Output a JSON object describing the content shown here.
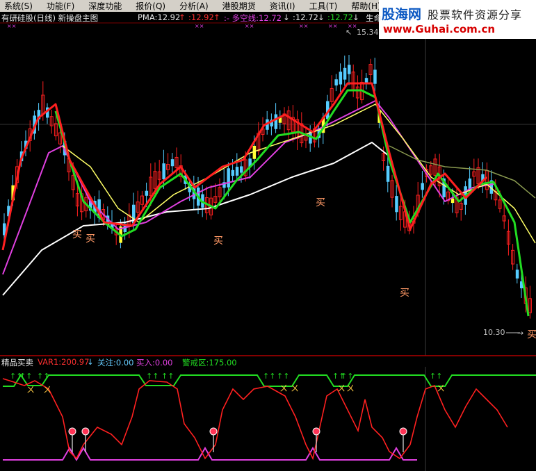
{
  "menu": {
    "items": [
      "系统(S)",
      "功能(F)",
      "深度功能",
      "报价(Q)",
      "分析(A)",
      "港股期货",
      "资讯(I)",
      "工具(T)",
      "帮助(H)"
    ]
  },
  "logo": {
    "brand": "股海网",
    "slogan": "股票软件资源分享",
    "url": "www.Guhai.com.cn"
  },
  "main_chart": {
    "title": "有研硅股(日线) 新操盘主图",
    "pma": "PMA:12.92",
    "v2": ":12.92",
    "duokong": ":- 多空线:12.72",
    "v4": ":12.72",
    "v5": ":12.72",
    "shengming": "生命",
    "high_label": "15.34",
    "low_label": "10.30",
    "buy_label": "买",
    "colors": {
      "up": "#ff2020",
      "down": "#55ccff",
      "ma_red": "#ff2020",
      "ma_green": "#22dd22",
      "ma_yellow": "#ffff66",
      "ma_magenta": "#e040e0",
      "ma_white": "#ffffff",
      "ma_olive": "#8a9a50"
    }
  },
  "sub_chart": {
    "name": "精品买卖",
    "var1": "VAR1:200.97",
    "guanzhu": "关注:0.00",
    "mairu": "买入:0.00",
    "jingjie": "警戒区:175.00",
    "colors": {
      "line": "#ff2020",
      "top": "#22dd22",
      "bottom": "#e040e0"
    }
  }
}
